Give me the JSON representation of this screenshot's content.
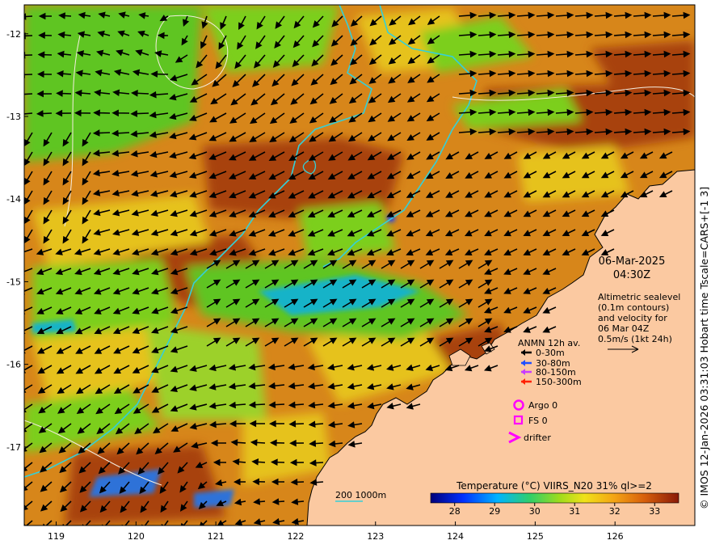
{
  "map": {
    "date": "06-Mar-2025",
    "time": "04:30Z",
    "lon_ticks": [
      "119",
      "120",
      "121",
      "122",
      "123",
      "124",
      "125",
      "126"
    ],
    "lat_ticks": [
      "-12",
      "-13",
      "-14",
      "-15",
      "-16",
      "-17"
    ],
    "lon_range": [
      118.6,
      127.0
    ],
    "lat_range": [
      -17.95,
      -11.65
    ],
    "colors": {
      "ocean_warm": "#d7861a",
      "ocean_hot": "#a8420e",
      "ocean_yellow": "#e6c21c",
      "ocean_green": "#5fc521",
      "ocean_cool": "#19b3c8",
      "land": "#fbc9a1",
      "contour_200": "#34d0d8",
      "sealevel_contour": "#f5ede0",
      "arrow": "#000000"
    }
  },
  "altimetry": {
    "lines": [
      "Altimetric sealevel",
      "(0.1m contours)",
      "and velocity for",
      "06 Mar 04Z",
      "0.5m/s (1kt 24h)"
    ]
  },
  "anmn": {
    "title": "ANMN 12h av.",
    "items": [
      {
        "label": "0-30m",
        "color": "#000000"
      },
      {
        "label": "30-80m",
        "color": "#1f4fff"
      },
      {
        "label": "80-150m",
        "color": "#c83cff"
      },
      {
        "label": "150-300m",
        "color": "#ff2000"
      }
    ]
  },
  "markers": {
    "argo": "Argo 0",
    "fs": "FS 0",
    "drifter": "drifter",
    "color": "#ff00ff"
  },
  "bathymetry": {
    "label": "200  1000m"
  },
  "colorbar": {
    "title": "Temperature (°C) VIIRS_N20 31% ql>=2",
    "ticks": [
      "28",
      "29",
      "30",
      "31",
      "32",
      "33"
    ],
    "range": [
      27.4,
      33.6
    ]
  },
  "credit": "© IMOS 12-Jan-2026 03:31:03 Hobart time Tscale=CARS+[-1 3]"
}
